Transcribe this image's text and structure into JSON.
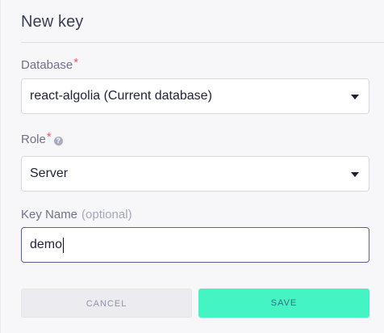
{
  "header": {
    "title": "New key"
  },
  "database": {
    "label": "Database",
    "required_mark": "*",
    "selected": "react-algolia (Current database)"
  },
  "role": {
    "label": "Role",
    "required_mark": "*",
    "help_glyph": "?",
    "selected": "Server"
  },
  "key_name": {
    "label": "Key Name",
    "optional_hint": "(optional)",
    "value": "demo"
  },
  "actions": {
    "cancel_label": "CANCEL",
    "save_label": "SAVE"
  },
  "colors": {
    "accent": "#45f4c3",
    "required": "#f05a6b",
    "focus_border": "#5a5f95"
  },
  "icons": [
    "chevron-down-icon",
    "help-icon"
  ]
}
